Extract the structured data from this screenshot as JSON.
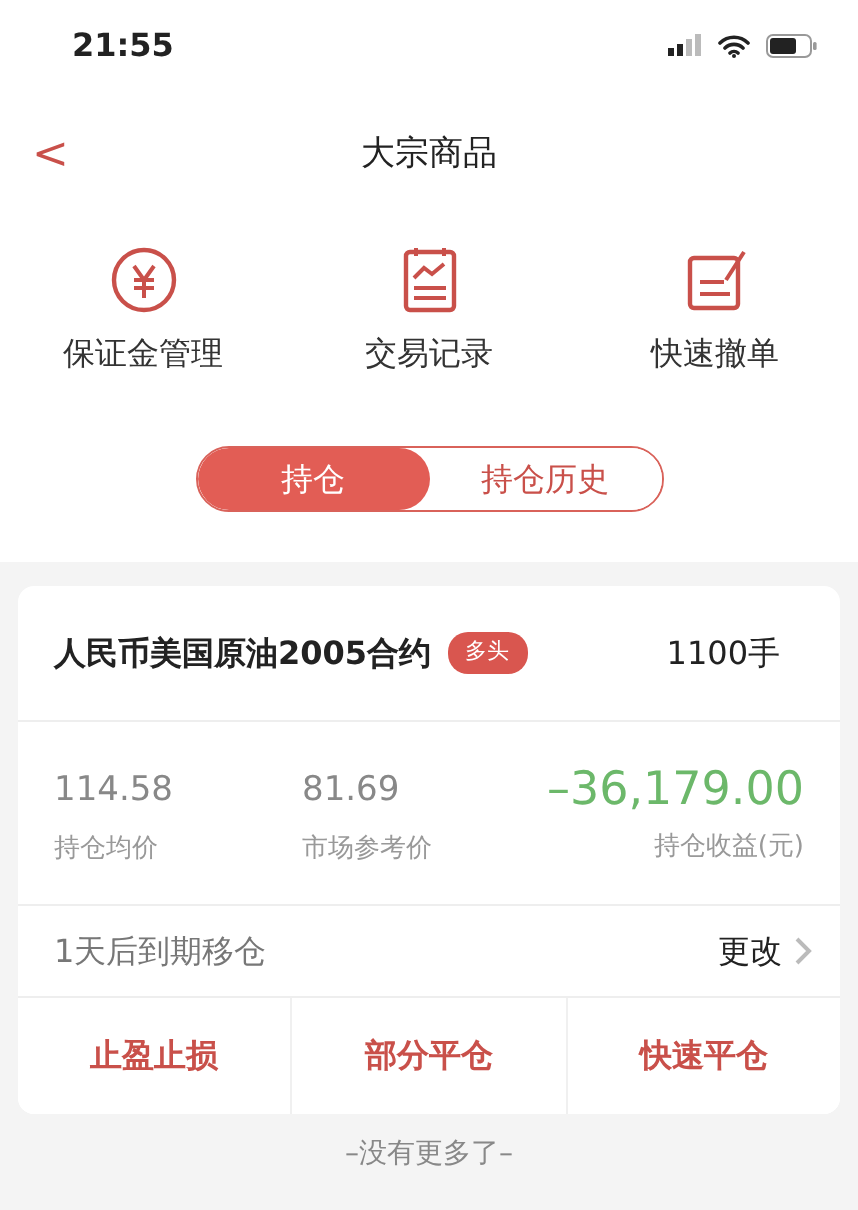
{
  "status_bar": {
    "time": "21:55"
  },
  "nav": {
    "back": "<",
    "title": "大宗商品"
  },
  "shortcuts": [
    {
      "kind": "yuan",
      "label": "保证金管理"
    },
    {
      "kind": "chart",
      "label": "交易记录"
    },
    {
      "kind": "edit",
      "label": "快速撤单"
    }
  ],
  "tabs": [
    {
      "label": "持仓",
      "selected": true
    },
    {
      "label": "持仓历史",
      "selected": false
    }
  ],
  "position": {
    "name": "人民币美国原油2005合约",
    "tag": "多头",
    "quantity": "1100手",
    "stats": [
      {
        "value": "114.58",
        "label": "持仓均价",
        "kind": "plain"
      },
      {
        "value": "81.69",
        "label": "市场参考价",
        "kind": "plain"
      },
      {
        "value": "–36,179.00",
        "label": "持仓收益(元)",
        "kind": "pnl"
      }
    ],
    "rollover": "1天后到期移仓",
    "rollover_action": "更改",
    "actions": [
      "止盈止损",
      "部分平仓",
      "快速平仓"
    ]
  },
  "footer": "–没有更多了–"
}
